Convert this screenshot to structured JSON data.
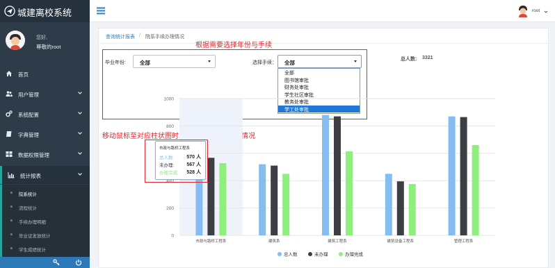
{
  "app": {
    "title": "城建离校系统"
  },
  "sidebar": {
    "greeting": "您好,",
    "username": "尊敬的root",
    "items": [
      {
        "label": "首页",
        "icon": "home-icon"
      },
      {
        "label": "用户管理",
        "icon": "users-icon"
      },
      {
        "label": "系统配置",
        "icon": "gears-icon"
      },
      {
        "label": "字典管理",
        "icon": "book-icon"
      },
      {
        "label": "数据权限管理",
        "icon": "grid-icon"
      },
      {
        "label": "统计报表",
        "icon": "bar-chart-icon"
      }
    ],
    "subitems": [
      {
        "label": "院系统计",
        "active": true
      },
      {
        "label": "流程统计"
      },
      {
        "label": "手续办理明细"
      },
      {
        "label": "毕业证发放统计"
      },
      {
        "label": "学生成绩统计"
      }
    ]
  },
  "topbar": {
    "user": "root"
  },
  "breadcrumb": {
    "parent": "查询统计报表",
    "separator": "/",
    "current": "院系手续办理情况"
  },
  "annotations": {
    "top": "根据需要选择年份与手续",
    "middle": "移动鼠标至对应柱状图时显示对应院系的具体情况"
  },
  "filters": {
    "year_label": "毕业年份:",
    "year_value": "全部",
    "proc_label": "选择手续：",
    "proc_value": "全部",
    "proc_options": [
      "全部",
      "图书馆审批",
      "财务处审批",
      "学生社区审批",
      "教务处审批",
      "学工处审批"
    ],
    "proc_selected_index": 5
  },
  "totals": {
    "label": "总人数:",
    "value": "3321"
  },
  "chart_data": {
    "type": "bar",
    "categories": [
      "市政与路桥工程系",
      "建筑系",
      "建筑工程系",
      "建筑设备工程系",
      "管理工程系"
    ],
    "series": [
      {
        "name": "总人数",
        "color": "#86bdf0",
        "values": [
          570,
          520,
          880,
          450,
          870
        ]
      },
      {
        "name": "未办理",
        "color": "#3d3e43",
        "values": [
          567,
          510,
          870,
          395,
          865
        ]
      },
      {
        "name": "办理完成",
        "color": "#90ee7e",
        "values": [
          528,
          450,
          615,
          375,
          660
        ]
      }
    ],
    "yticks": [
      0,
      200,
      400,
      600,
      800,
      1000
    ],
    "ylim": [
      0,
      1000
    ],
    "ylabel": "",
    "grid": true,
    "highlight_category_index": 0,
    "legend_position": "bottom"
  },
  "tooltip": {
    "title": "市政与路桥工程系",
    "rows": [
      {
        "label": "总人数:",
        "value": "570 人",
        "color": "#86bdf0"
      },
      {
        "label": "未办理:",
        "value": "567 人",
        "color": "#3d3e43"
      },
      {
        "label": "办理完成:",
        "value": "528 人",
        "color": "#90ee7e"
      }
    ]
  }
}
